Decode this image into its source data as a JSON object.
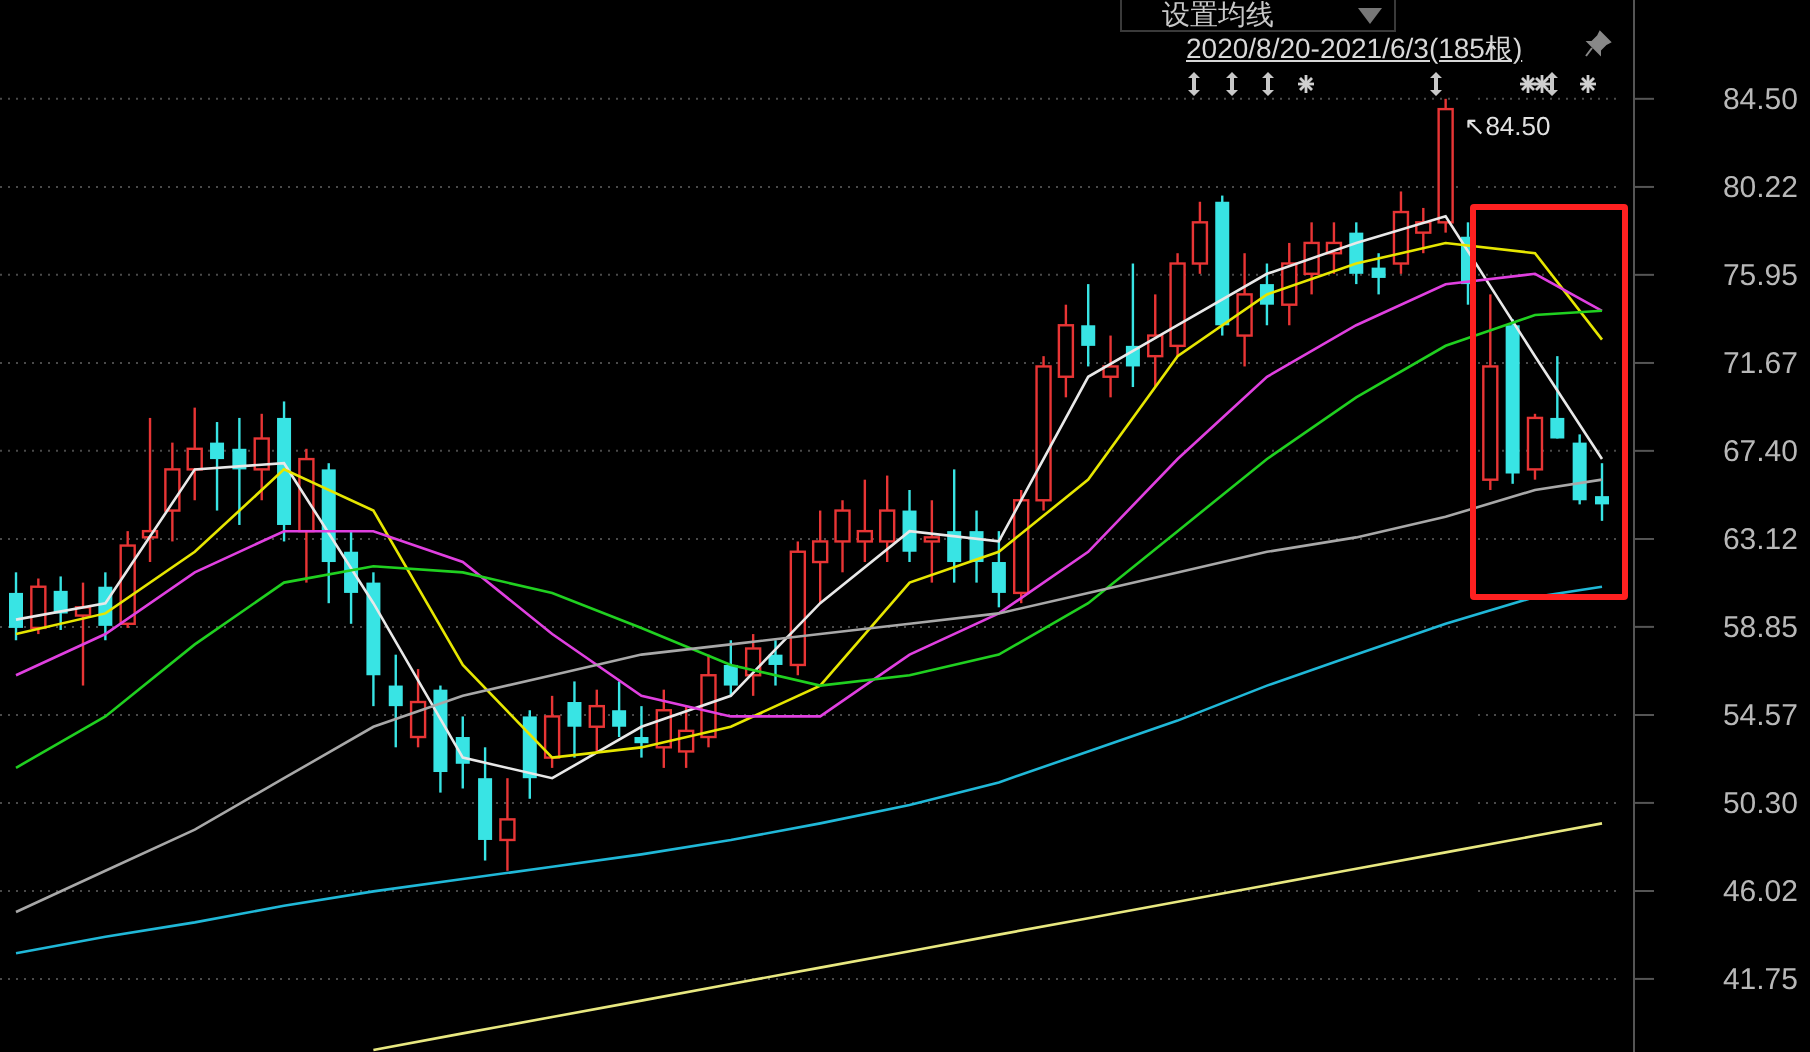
{
  "toolbar": {
    "ma_settings": {
      "label": "设置均线"
    },
    "date_range": "2020/8/20-2021/6/3(185根)"
  },
  "chart": {
    "candles": {
      "chart_data": {
        "type": "candlestick",
        "ylim": [
          38.2,
          89.3
        ],
        "grid": true,
        "yticks": [
          {
            "value": 84.5,
            "label": "84.50"
          },
          {
            "value": 80.22,
            "label": "80.22"
          },
          {
            "value": 75.95,
            "label": "75.95"
          },
          {
            "value": 71.67,
            "label": "71.67"
          },
          {
            "value": 67.4,
            "label": "67.40"
          },
          {
            "value": 63.12,
            "label": "63.12"
          },
          {
            "value": 58.85,
            "label": "58.85"
          },
          {
            "value": 54.57,
            "label": "54.57"
          },
          {
            "value": 50.3,
            "label": "50.30"
          },
          {
            "value": 46.02,
            "label": "46.02"
          },
          {
            "value": 41.75,
            "label": "41.75"
          }
        ],
        "categories": [
          null,
          null,
          null,
          null,
          null,
          null,
          null,
          null,
          null,
          null,
          null,
          null,
          null,
          null,
          null,
          null,
          null,
          null,
          null,
          null,
          null,
          null,
          null,
          null,
          null,
          null,
          null,
          null,
          null,
          null,
          null,
          null,
          null,
          null,
          null,
          null,
          null,
          null,
          null,
          null,
          null,
          null,
          null,
          null,
          null,
          null,
          null,
          null,
          null,
          null,
          null,
          null,
          null,
          null,
          null,
          null,
          null,
          null,
          null,
          null,
          null,
          null,
          null,
          null,
          null,
          null,
          null,
          null,
          null,
          null,
          null,
          null
        ],
        "ohlc": [
          [
            60.5,
            61.5,
            58.2,
            58.8
          ],
          [
            58.8,
            61.2,
            58.5,
            60.8
          ],
          [
            60.6,
            61.3,
            58.7,
            59.5
          ],
          [
            59.4,
            61.0,
            56.0,
            59.8
          ],
          [
            60.8,
            61.5,
            58.2,
            58.9
          ],
          [
            59.0,
            63.5,
            58.8,
            62.8
          ],
          [
            63.2,
            69.0,
            62.0,
            63.5
          ],
          [
            64.5,
            67.8,
            63.0,
            66.5
          ],
          [
            66.5,
            69.5,
            65.0,
            67.5
          ],
          [
            67.8,
            68.8,
            64.5,
            67.0
          ],
          [
            67.5,
            69.0,
            63.8,
            66.5
          ],
          [
            66.5,
            69.2,
            65.0,
            68.0
          ],
          [
            69.0,
            69.8,
            63.0,
            63.8
          ],
          [
            63.5,
            67.5,
            61.0,
            67.0
          ],
          [
            66.5,
            66.8,
            60.0,
            62.0
          ],
          [
            62.5,
            63.5,
            59.0,
            60.5
          ],
          [
            61.0,
            61.5,
            55.0,
            56.5
          ],
          [
            56.0,
            57.5,
            53.0,
            55.0
          ],
          [
            53.5,
            56.8,
            53.0,
            55.2
          ],
          [
            55.8,
            56.0,
            50.8,
            51.8
          ],
          [
            53.5,
            54.5,
            51.0,
            52.2
          ],
          [
            51.5,
            53.0,
            47.5,
            48.5
          ],
          [
            48.5,
            51.5,
            47.0,
            49.5
          ],
          [
            54.5,
            54.8,
            50.5,
            51.5
          ],
          [
            52.5,
            55.5,
            52.0,
            54.5
          ],
          [
            55.2,
            56.2,
            52.5,
            54.0
          ],
          [
            54.0,
            55.8,
            52.8,
            55.0
          ],
          [
            54.8,
            56.2,
            53.5,
            54.0
          ],
          [
            53.5,
            55.0,
            52.5,
            53.2
          ],
          [
            53.0,
            55.8,
            52.0,
            54.8
          ],
          [
            52.8,
            55.0,
            52.0,
            53.8
          ],
          [
            53.5,
            57.5,
            53.0,
            56.5
          ],
          [
            57.0,
            58.2,
            55.5,
            56.0
          ],
          [
            56.5,
            58.5,
            55.5,
            57.8
          ],
          [
            57.5,
            58.2,
            56.0,
            57.0
          ],
          [
            57.0,
            63.0,
            56.5,
            62.5
          ],
          [
            62.0,
            64.5,
            60.0,
            63.0
          ],
          [
            63.0,
            65.0,
            61.5,
            64.5
          ],
          [
            63.0,
            66.0,
            62.0,
            63.5
          ],
          [
            63.0,
            66.2,
            62.0,
            64.5
          ],
          [
            64.5,
            65.5,
            62.0,
            62.5
          ],
          [
            63.0,
            65.0,
            61.0,
            63.2
          ],
          [
            63.5,
            66.5,
            61.0,
            62.0
          ],
          [
            63.5,
            64.5,
            61.0,
            62.0
          ],
          [
            62.0,
            63.5,
            59.8,
            60.5
          ],
          [
            60.5,
            65.5,
            60.0,
            65.0
          ],
          [
            65.0,
            72.0,
            64.5,
            71.5
          ],
          [
            71.0,
            74.5,
            70.0,
            73.5
          ],
          [
            73.5,
            75.5,
            71.5,
            72.5
          ],
          [
            71.0,
            73.0,
            70.0,
            71.5
          ],
          [
            72.5,
            76.5,
            70.5,
            71.5
          ],
          [
            72.0,
            75.0,
            70.5,
            73.0
          ],
          [
            72.5,
            77.0,
            72.0,
            76.5
          ],
          [
            76.5,
            79.5,
            76.0,
            78.5
          ],
          [
            79.5,
            79.8,
            73.0,
            73.5
          ],
          [
            73.0,
            77.0,
            71.5,
            75.0
          ],
          [
            75.5,
            76.5,
            73.5,
            74.5
          ],
          [
            74.5,
            77.5,
            73.5,
            76.5
          ],
          [
            76.0,
            78.5,
            75.0,
            77.5
          ],
          [
            77.0,
            78.5,
            76.0,
            77.5
          ],
          [
            78.0,
            78.5,
            75.5,
            76.0
          ],
          [
            76.3,
            77.0,
            75.0,
            75.8
          ],
          [
            76.5,
            80.0,
            76.0,
            79.0
          ],
          [
            78.0,
            79.2,
            77.0,
            78.5
          ],
          [
            78.5,
            84.5,
            78.0,
            84.0
          ],
          [
            77.8,
            78.5,
            74.5,
            75.5
          ],
          [
            66.0,
            75.0,
            65.5,
            71.5
          ],
          [
            73.5,
            73.8,
            65.8,
            66.3
          ],
          [
            66.5,
            69.2,
            66.0,
            69.0
          ],
          [
            69.0,
            72.0,
            68.0,
            68.0
          ],
          [
            67.8,
            68.2,
            64.8,
            65.0
          ],
          [
            65.2,
            66.8,
            64.0,
            64.8
          ]
        ],
        "annotations": [
          {
            "text": "↖84.50"
          }
        ],
        "series": [
          {
            "type": "line",
            "color": "#e8e8e8",
            "values": [
              59.2,
              null,
              null,
              null,
              60,
              null,
              null,
              null,
              66.5,
              null,
              null,
              null,
              66.8,
              null,
              null,
              null,
              60,
              null,
              null,
              null,
              52.5,
              null,
              null,
              null,
              51.5,
              null,
              null,
              null,
              54,
              null,
              null,
              null,
              55.5,
              null,
              null,
              null,
              60,
              null,
              null,
              null,
              63.5,
              null,
              null,
              null,
              63,
              null,
              null,
              null,
              71,
              null,
              null,
              null,
              73.5,
              null,
              null,
              null,
              76,
              null,
              null,
              null,
              77.5,
              null,
              null,
              null,
              78.8,
              null,
              null,
              null,
              72,
              null,
              null,
              67
            ]
          },
          {
            "type": "line",
            "color": "#e6e600",
            "values": [
              58.5,
              null,
              null,
              null,
              59.5,
              null,
              null,
              null,
              62.5,
              null,
              null,
              null,
              66.5,
              null,
              null,
              null,
              64.5,
              null,
              null,
              null,
              57,
              null,
              null,
              null,
              52.5,
              null,
              null,
              null,
              53,
              null,
              null,
              null,
              54,
              null,
              null,
              null,
              56,
              null,
              null,
              null,
              61,
              null,
              null,
              null,
              62.5,
              null,
              null,
              null,
              66,
              null,
              null,
              null,
              72,
              null,
              null,
              null,
              75,
              null,
              null,
              null,
              76.5,
              null,
              null,
              null,
              77.5,
              null,
              null,
              null,
              77,
              null,
              null,
              72.8
            ]
          },
          {
            "type": "line",
            "color": "#e040e0",
            "values": [
              56.5,
              null,
              null,
              null,
              58.5,
              null,
              null,
              null,
              61.5,
              null,
              null,
              null,
              63.5,
              null,
              null,
              null,
              63.5,
              null,
              null,
              null,
              62,
              null,
              null,
              null,
              58.5,
              null,
              null,
              null,
              55.5,
              null,
              null,
              null,
              54.5,
              null,
              null,
              null,
              54.5,
              null,
              null,
              null,
              57.5,
              null,
              null,
              null,
              59.5,
              null,
              null,
              null,
              62.5,
              null,
              null,
              null,
              67,
              null,
              null,
              null,
              71,
              null,
              null,
              null,
              73.5,
              null,
              null,
              null,
              75.5,
              null,
              null,
              null,
              76,
              null,
              null,
              74.2
            ]
          },
          {
            "type": "line",
            "color": "#20d020",
            "values": [
              52,
              null,
              null,
              null,
              54.5,
              null,
              null,
              null,
              58,
              null,
              null,
              null,
              61,
              null,
              null,
              null,
              61.8,
              null,
              null,
              null,
              61.5,
              null,
              null,
              null,
              60.5,
              null,
              null,
              null,
              58.8,
              null,
              null,
              null,
              57,
              null,
              null,
              null,
              56,
              null,
              null,
              null,
              56.5,
              null,
              null,
              null,
              57.5,
              null,
              null,
              null,
              60,
              null,
              null,
              null,
              63.5,
              null,
              null,
              null,
              67,
              null,
              null,
              null,
              70,
              null,
              null,
              null,
              72.5,
              null,
              null,
              null,
              74,
              null,
              null,
              74.2
            ]
          },
          {
            "type": "line",
            "color": "#a8a8a8",
            "values": [
              45,
              null,
              null,
              null,
              47,
              null,
              null,
              null,
              49,
              null,
              null,
              null,
              51.5,
              null,
              null,
              null,
              54,
              null,
              null,
              null,
              55.5,
              null,
              null,
              null,
              56.5,
              null,
              null,
              null,
              57.5,
              null,
              null,
              null,
              58,
              null,
              null,
              null,
              58.5,
              null,
              null,
              null,
              59,
              null,
              null,
              null,
              59.5,
              null,
              null,
              null,
              60.5,
              null,
              null,
              null,
              61.5,
              null,
              null,
              null,
              62.5,
              null,
              null,
              null,
              63.2,
              null,
              null,
              null,
              64.2,
              null,
              null,
              null,
              65.5,
              null,
              null,
              66
            ]
          },
          {
            "type": "line",
            "color": "#20b8d8",
            "values": [
              43,
              null,
              null,
              null,
              43.8,
              null,
              null,
              null,
              44.5,
              null,
              null,
              null,
              45.3,
              null,
              null,
              null,
              46,
              null,
              null,
              null,
              46.6,
              null,
              null,
              null,
              47.2,
              null,
              null,
              null,
              47.8,
              null,
              null,
              null,
              48.5,
              null,
              null,
              null,
              49.3,
              null,
              null,
              null,
              50.2,
              null,
              null,
              null,
              51.3,
              null,
              null,
              null,
              52.8,
              null,
              null,
              null,
              54.3,
              null,
              null,
              null,
              56,
              null,
              null,
              null,
              57.5,
              null,
              null,
              null,
              59,
              null,
              null,
              null,
              60.3,
              null,
              null,
              60.8
            ]
          },
          {
            "type": "line",
            "color": "#e8e880",
            "values": [
              null,
              null,
              null,
              null,
              null,
              null,
              null,
              null,
              null,
              null,
              null,
              null,
              null,
              null,
              null,
              null,
              38.3,
              null,
              null,
              null,
              39.1,
              null,
              null,
              null,
              39.9,
              null,
              null,
              null,
              40.7,
              null,
              null,
              null,
              41.5,
              null,
              null,
              null,
              42.3,
              null,
              null,
              null,
              43.1,
              null,
              null,
              null,
              43.9,
              null,
              null,
              null,
              44.7,
              null,
              null,
              null,
              45.5,
              null,
              null,
              null,
              46.3,
              null,
              null,
              null,
              47.1,
              null,
              null,
              null,
              47.9,
              null,
              null,
              null,
              48.7,
              null,
              null,
              49.3
            ]
          }
        ]
      }
    }
  }
}
